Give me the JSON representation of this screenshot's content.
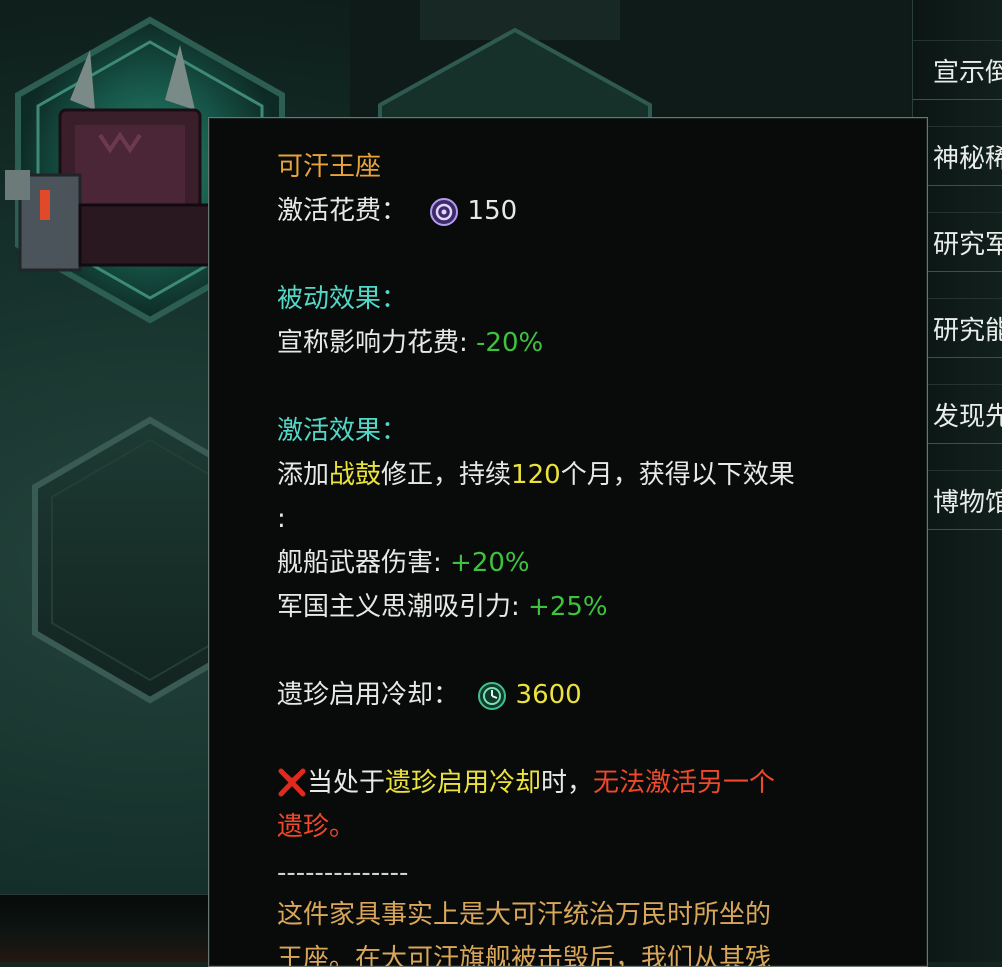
{
  "relic": {
    "name": "可汗王座",
    "activation_cost_label": "激活花费：",
    "activation_cost_icon": "influence-icon",
    "activation_cost_value": "150",
    "passive_title": "被动效果：",
    "passive_label": "宣称影响力花费:",
    "passive_value": "-20%",
    "active_title": "激活效果：",
    "active_prefix": "添加",
    "active_modifier": "战鼓",
    "active_mid": "修正，持续",
    "active_months": "120",
    "active_suffix": "个月，获得以下效果",
    "active_colon": ":",
    "effect1_label": "舰船武器伤害:",
    "effect1_value": "+20%",
    "effect2_label": "军国主义思潮吸引力:",
    "effect2_value": "+25%",
    "cooldown_label": "遗珍启用冷却：",
    "cooldown_icon": "clock-icon",
    "cooldown_value": "3600",
    "warning_icon": "red-x-icon",
    "warning_prefix": "当处于",
    "warning_highlight": "遗珍启用冷却",
    "warning_mid": "时，",
    "warning_red1": "无法激活另一个",
    "warning_red2": "遗珍。",
    "separator": "--------------",
    "lore_line1": "这件家具事实上是大可汗统治万民时所坐的",
    "lore_line2": "王座。在大可汗旗舰被击毁后，我们从其残"
  },
  "side_menu": {
    "items": [
      {
        "label": "宣示倒"
      },
      {
        "label": "神秘稀"
      },
      {
        "label": "研究军"
      },
      {
        "label": "研究能"
      },
      {
        "label": "发现先"
      },
      {
        "label": "博物馆"
      }
    ]
  },
  "colors": {
    "title": "#e8a33a",
    "section": "#52d8c8",
    "positive": "#3fc23f",
    "highlight": "#ece23c",
    "negative": "#f1472a",
    "lore": "#d9a65a"
  }
}
